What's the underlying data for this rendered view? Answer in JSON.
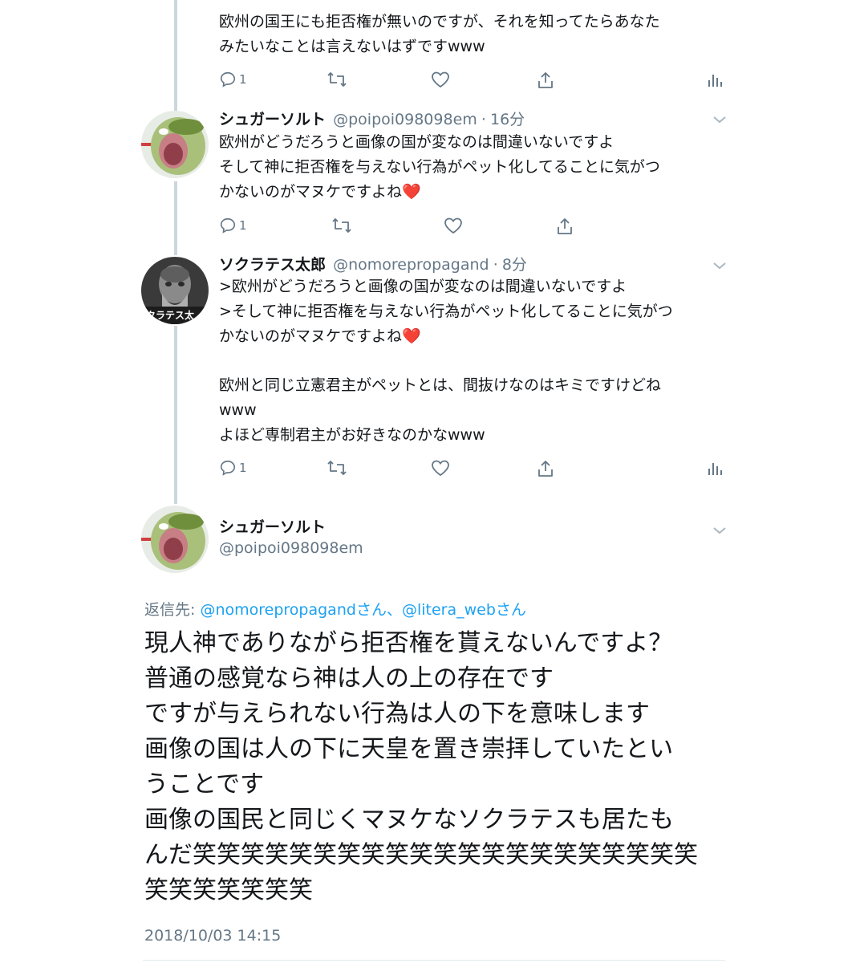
{
  "tweet1": {
    "text": "欧州の国王にも拒否権が無いのですが、それを知ってたらあなた\nみたいなことは言えないはずですwww",
    "reply_count": "1"
  },
  "tweet2": {
    "name": "シュガーソルト",
    "handle": "@poipoi098098em",
    "sep": "·",
    "time": "16分",
    "text": "欧州がどうだろうと画像の国が変なのは間違いないですよ\nそして神に拒否権を与えない行為がペット化してることに気がつ\nかないのがマヌケですよね",
    "emoji": "❤️",
    "reply_count": "1"
  },
  "tweet3": {
    "name": "ソクラテス太郎",
    "handle": "@nomorepropagand",
    "sep": "·",
    "time": "8分",
    "avatar_caption": "クラテス太",
    "text_a": ">欧州がどうだろうと画像の国が変なのは間違いないですよ\n>そして神に拒否権を与えない行為がペット化してることに気がつ\nかないのがマヌケですよね",
    "emoji": "❤️",
    "text_b": "欧州と同じ立憲君主がペットとは、間抜けなのはキミですけどね\nwww\nよほど専制君主がお好きなのかなwww",
    "reply_count": "1"
  },
  "main_tweet": {
    "name": "シュガーソルト",
    "handle": "@poipoi098098em",
    "reply_prefix": "返信先: ",
    "reply_user1": "@nomorepropagand",
    "reply_san1": "さん、",
    "reply_user2": "@litera_web",
    "reply_san2": "さん",
    "text": "現人神でありながら拒否権を貰えないんですよ？\n普通の感覚なら神は人の上の存在です\nですが与えられない行為は人の下を意味します\n画像の国は人の下に天皇を置き崇拝していたとい\nうことです\n画像の国民と同じくマヌケなソクラテスも居たも\nんだ笑笑笑笑笑笑笑笑笑笑笑笑笑笑笑笑笑笑笑笑笑\n笑笑笑笑笑笑笑",
    "timestamp": "2018/10/03 14:15"
  },
  "colors": {
    "text": "#14171a",
    "secondary": "#657786",
    "link": "#1da1f2",
    "thread_line": "#ccd6dd",
    "heart_emoji": "#e0245e"
  },
  "icons": [
    "reply-icon",
    "retweet-icon",
    "like-icon",
    "share-icon",
    "analytics-icon",
    "chevron-down-icon"
  ]
}
